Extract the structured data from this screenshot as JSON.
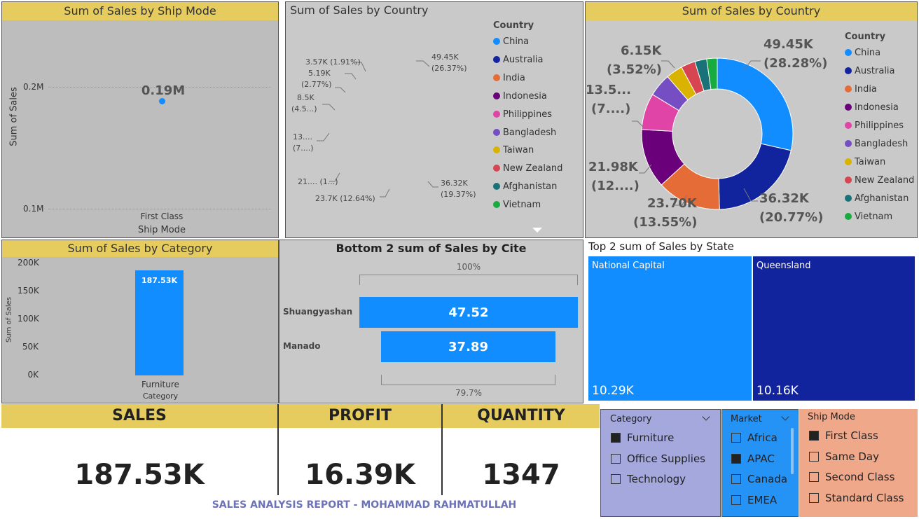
{
  "report_footer": "SALES ANALYSIS REPORT - MOHAMMAD RAHMATULLAH",
  "countries": [
    {
      "name": "China",
      "color": "#118dff"
    },
    {
      "name": "Australia",
      "color": "#12239e"
    },
    {
      "name": "India",
      "color": "#e66c37"
    },
    {
      "name": "Indonesia",
      "color": "#6b007b"
    },
    {
      "name": "Philippines",
      "color": "#e044a7"
    },
    {
      "name": "Bangladesh",
      "color": "#744ec2"
    },
    {
      "name": "Taiwan",
      "color": "#d9b300"
    },
    {
      "name": "New Zealand",
      "color": "#d64550"
    },
    {
      "name": "Afghanistan",
      "color": "#197278"
    },
    {
      "name": "Vietnam",
      "color": "#1aab40"
    }
  ],
  "ship_mode_chart": {
    "title": "Sum of Sales by Ship Mode",
    "ylabel": "Sum of Sales",
    "xlabel": "Ship Mode",
    "ytick_top": "0.2M",
    "ytick_bottom": "0.1M",
    "category": "First Class",
    "value_label": "0.19M"
  },
  "country_chart_small": {
    "title": "Sum of Sales by Country",
    "legend_title": "Country",
    "labels": {
      "china": "49.45K\n(26.37%)",
      "australia": "36.32K\n(19.37%)",
      "india": "23.7K (12.64%)",
      "indonesia": "21.... (1...)",
      "philippines": "13....\n(7....)",
      "bangladesh": "8.5K\n(4.5...)",
      "taiwan": "5.19K\n(2.77%)",
      "nz": "3.57K (1.91%)"
    }
  },
  "country_chart_large": {
    "title": "Sum of Sales by Country",
    "legend_title": "Country",
    "labels": {
      "china_a": "49.45K",
      "china_b": "(28.28%)",
      "australia_a": "36.32K",
      "australia_b": "(20.77%)",
      "india_a": "23.70K",
      "india_b": "(13.55%)",
      "indonesia_a": "21.98K",
      "indonesia_b": "(12....)",
      "philippines_a": "13.5...",
      "philippines_b": "(7....)",
      "taiwan_a": "6.15K",
      "taiwan_b": "(3.52%)"
    }
  },
  "category_chart": {
    "title": "Sum of Sales by Category",
    "ylabel": "Sum of Sales",
    "xlabel": "Category",
    "yticks": [
      "200K",
      "150K",
      "100K",
      "50K",
      "0K"
    ],
    "category": "Furniture",
    "value_label": "187.53K"
  },
  "cite_chart": {
    "title": "Bottom 2 sum of Sales by Cite",
    "top_pct": "100%",
    "bottom_pct": "79.7%",
    "rows": [
      {
        "city": "Shuangyashan",
        "value": "47.52"
      },
      {
        "city": "Manado",
        "value": "37.89"
      }
    ]
  },
  "state_chart": {
    "title": "Top 2 sum of Sales by State",
    "tiles": [
      {
        "state": "National Capital",
        "value": "10.29K"
      },
      {
        "state": "Queensland",
        "value": "10.16K"
      }
    ]
  },
  "kpis": {
    "sales_label": "SALES",
    "sales_value": "187.53K",
    "profit_label": "PROFIT",
    "profit_value": "16.39K",
    "quantity_label": "QUANTITY",
    "quantity_value": "1347"
  },
  "slicers": {
    "category": {
      "title": "Category",
      "items": [
        "Furniture",
        "Office Supplies",
        "Technology"
      ]
    },
    "market": {
      "title": "Market",
      "items": [
        "Africa",
        "APAC",
        "Canada",
        "EMEA"
      ]
    },
    "ship_mode": {
      "title": "Ship Mode",
      "items": [
        "First Class",
        "Same Day",
        "Second Class",
        "Standard Class"
      ]
    }
  },
  "chart_data": [
    {
      "type": "scatter",
      "title": "Sum of Sales by Ship Mode",
      "xlabel": "Ship Mode",
      "ylabel": "Sum of Sales",
      "categories": [
        "First Class"
      ],
      "values": [
        0.19
      ],
      "units": "M",
      "ylim": [
        0.1,
        0.2
      ]
    },
    {
      "type": "pie",
      "title": "Sum of Sales by Country",
      "categories": [
        "China",
        "Australia",
        "India",
        "Indonesia",
        "Philippines",
        "Bangladesh",
        "Taiwan",
        "New Zealand",
        "Afghanistan",
        "Vietnam"
      ],
      "values": [
        49.45,
        36.32,
        23.7,
        21.0,
        13.5,
        8.5,
        5.19,
        3.57,
        3.2,
        3.0
      ],
      "units": "K"
    },
    {
      "type": "pie",
      "title": "Sum of Sales by Country",
      "categories": [
        "China",
        "Australia",
        "India",
        "Indonesia",
        "Philippines",
        "Bangladesh",
        "Taiwan",
        "New Zealand",
        "Afghanistan",
        "Vietnam"
      ],
      "values": [
        49.45,
        36.32,
        23.7,
        21.98,
        13.5,
        8.5,
        6.15,
        5.3,
        4.4,
        3.9
      ],
      "units": "K"
    },
    {
      "type": "bar",
      "title": "Sum of Sales by Category",
      "xlabel": "Category",
      "ylabel": "Sum of Sales",
      "categories": [
        "Furniture"
      ],
      "values": [
        187.53
      ],
      "units": "K",
      "ylim": [
        0,
        200
      ]
    },
    {
      "type": "bar",
      "title": "Bottom 2 sum of Sales by Cite",
      "categories": [
        "Shuangyashan",
        "Manado"
      ],
      "values": [
        47.52,
        37.89
      ],
      "percent_of_first": [
        100,
        79.7
      ]
    },
    {
      "type": "heatmap",
      "title": "Top 2 sum of Sales by State",
      "categories": [
        "National Capital",
        "Queensland"
      ],
      "values": [
        10.29,
        10.16
      ],
      "units": "K"
    }
  ]
}
